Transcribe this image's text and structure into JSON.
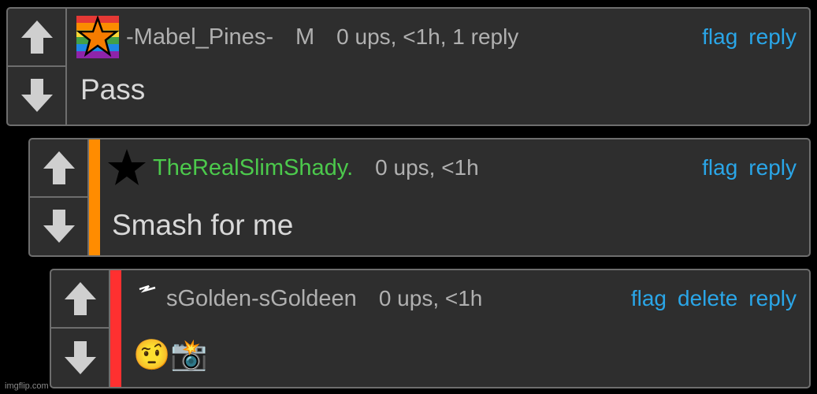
{
  "comments": [
    {
      "username": "-Mabel_Pines-",
      "mod_flag": "M",
      "meta": "0 ups, <1h, 1 reply",
      "actions": [
        "flag",
        "reply"
      ],
      "body": "Pass",
      "badge_icon": "rainbow-star-icon",
      "username_color": "#b0b0b0"
    },
    {
      "username": "TheRealSlimShady.",
      "meta": "0 ups, <1h",
      "actions": [
        "flag",
        "reply"
      ],
      "body": "Smash for me",
      "badge_icon": "black-star-icon",
      "username_color": "#4cc94c",
      "depth_color": "#ff8c00"
    },
    {
      "username": "sGolden-sGoldeen",
      "meta": "0 ups, <1h",
      "actions": [
        "flag",
        "delete",
        "reply"
      ],
      "body": "🤨📸",
      "badge_icon": "lightning-icon",
      "username_color": "#b0b0b0",
      "depth_color": "#ff3030"
    }
  ],
  "watermark": "imgflip.com"
}
